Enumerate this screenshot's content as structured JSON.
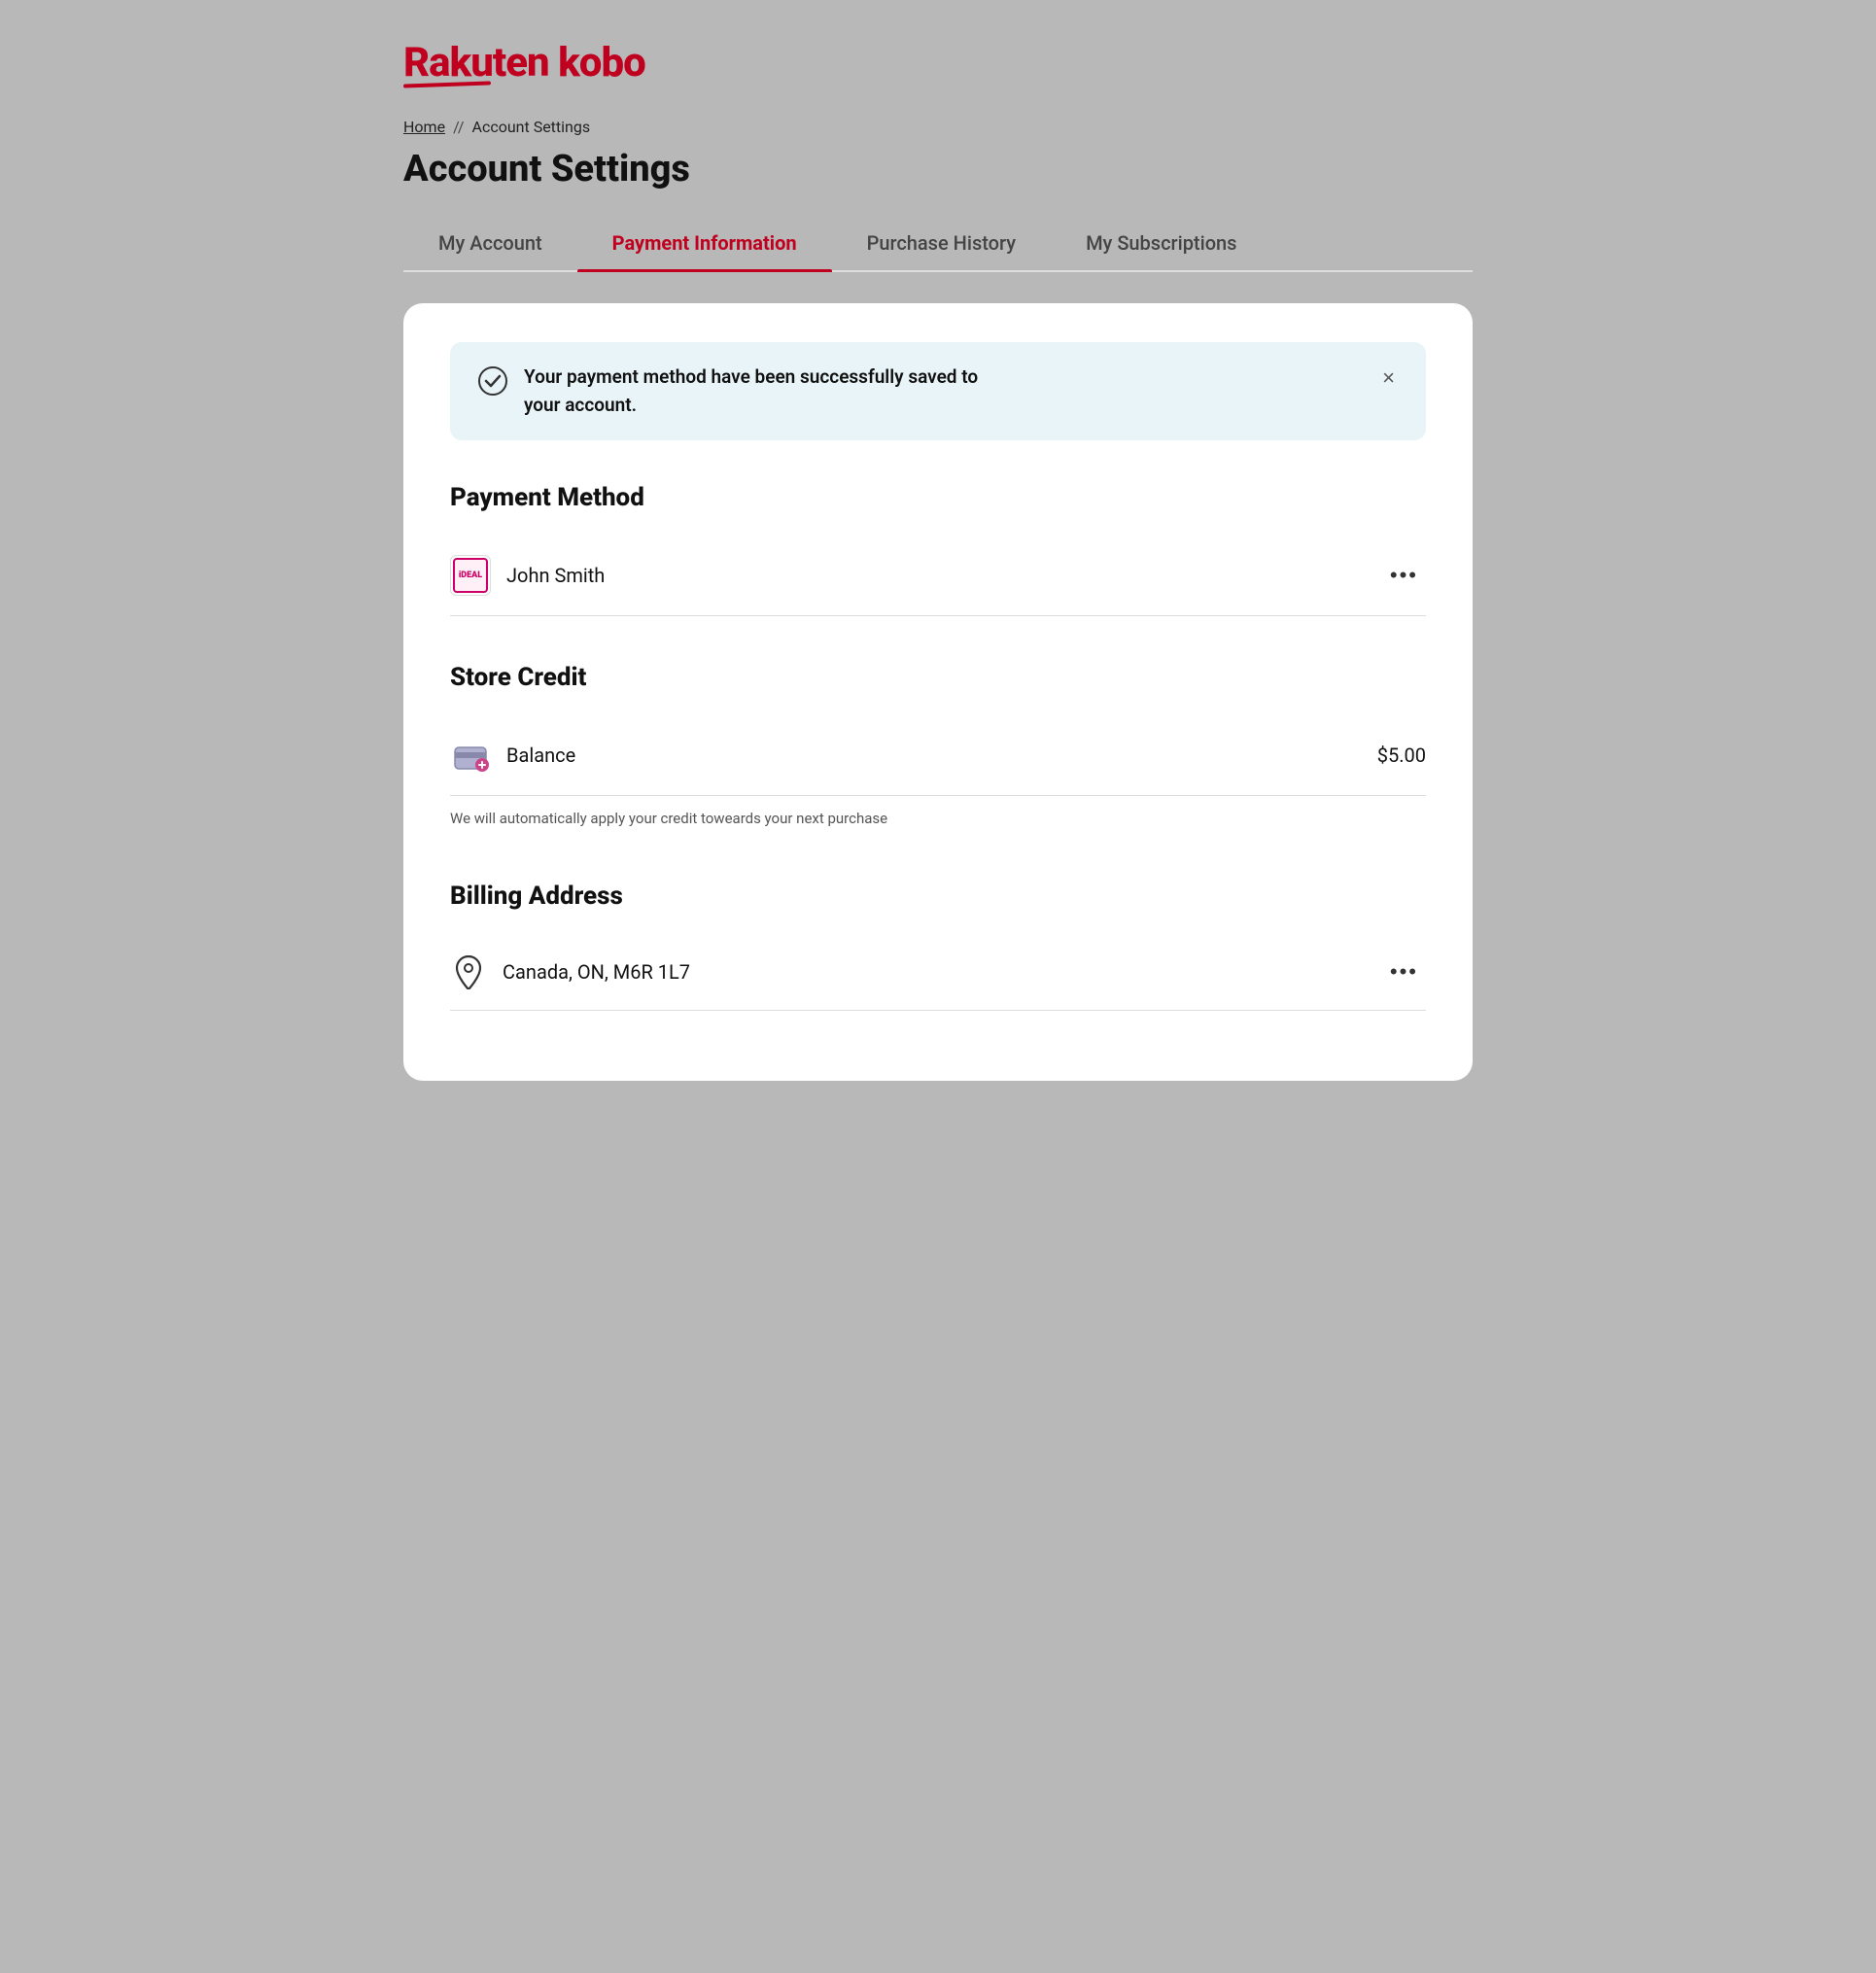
{
  "logo": {
    "text": "Rakuten kobo"
  },
  "breadcrumb": {
    "home": "Home",
    "separator": "//",
    "current": "Account Settings"
  },
  "page_title": "Account Settings",
  "tabs": [
    {
      "id": "my-account",
      "label": "My Account",
      "active": false
    },
    {
      "id": "payment-information",
      "label": "Payment Information",
      "active": true
    },
    {
      "id": "purchase-history",
      "label": "Purchase History",
      "active": false
    },
    {
      "id": "my-subscriptions",
      "label": "My Subscriptions",
      "active": false
    }
  ],
  "success_banner": {
    "message_line1": "Your payment method have been successfully saved to",
    "message_line2": "your account.",
    "close_label": "×"
  },
  "payment_method": {
    "title": "Payment Method",
    "item": {
      "name": "John Smith",
      "icon": "iDEAL"
    }
  },
  "store_credit": {
    "title": "Store Credit",
    "balance_label": "Balance",
    "balance_value": "$5.00",
    "note": "We will automatically apply your credit toweards your next purchase"
  },
  "billing_address": {
    "title": "Billing Address",
    "address": "Canada, ON, M6R 1L7"
  }
}
